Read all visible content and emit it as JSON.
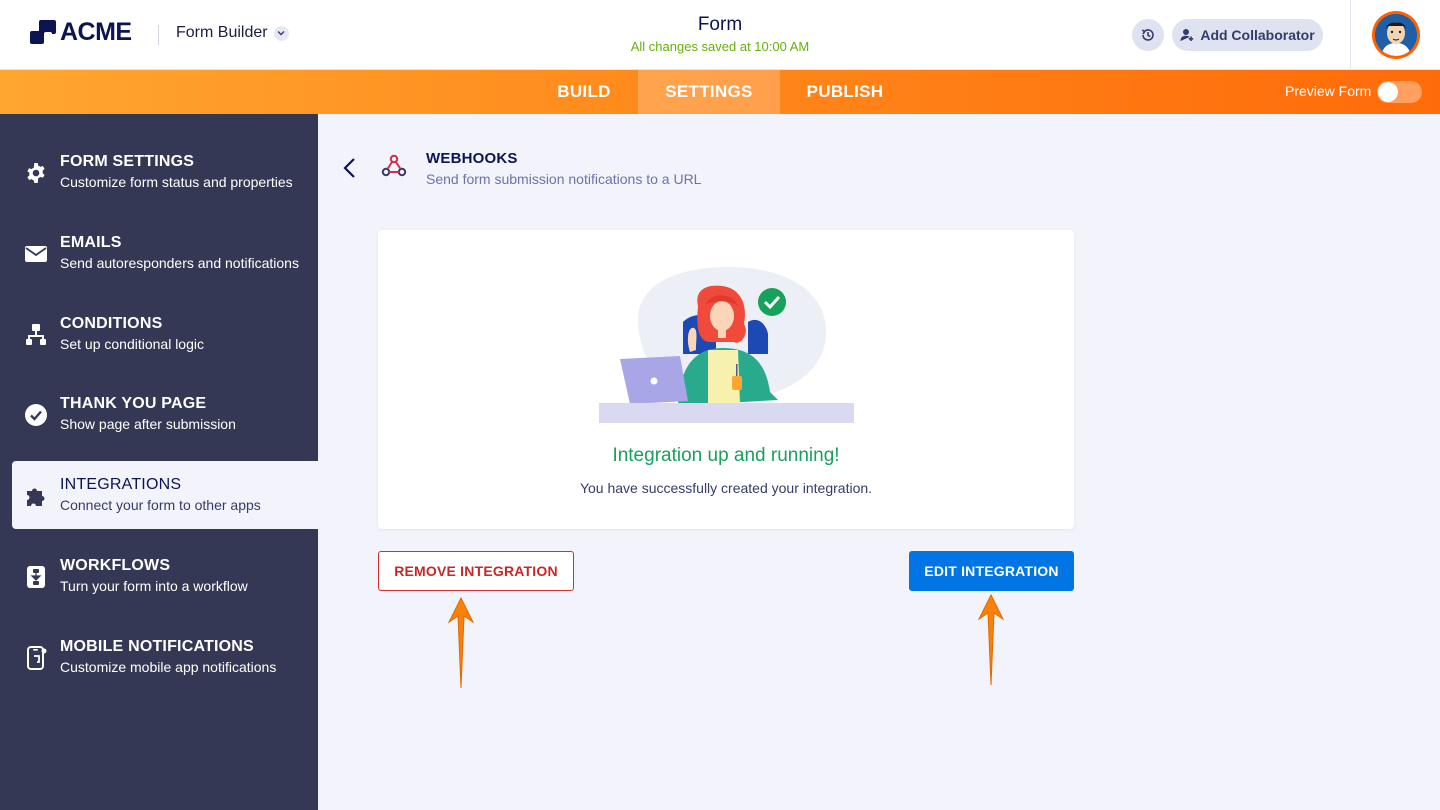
{
  "header": {
    "logo_text": "ACME",
    "app_switcher_label": "Form Builder",
    "form_title": "Form",
    "save_status": "All changes saved at 10:00 AM",
    "add_collaborator_label": "Add Collaborator"
  },
  "nav": {
    "tabs": [
      {
        "label": "BUILD",
        "active": false
      },
      {
        "label": "SETTINGS",
        "active": true
      },
      {
        "label": "PUBLISH",
        "active": false
      }
    ],
    "preview_label": "Preview Form",
    "preview_enabled": false
  },
  "sidebar": {
    "items": [
      {
        "title": "FORM SETTINGS",
        "subtitle": "Customize form status and properties",
        "icon": "gear-icon",
        "active": false
      },
      {
        "title": "EMAILS",
        "subtitle": "Send autoresponders and notifications",
        "icon": "envelope-icon",
        "active": false
      },
      {
        "title": "CONDITIONS",
        "subtitle": "Set up conditional logic",
        "icon": "flow-tree-icon",
        "active": false
      },
      {
        "title": "THANK YOU PAGE",
        "subtitle": "Show page after submission",
        "icon": "check-circle-icon",
        "active": false
      },
      {
        "title": "INTEGRATIONS",
        "subtitle": "Connect your form to other apps",
        "icon": "puzzle-icon",
        "active": true
      },
      {
        "title": "WORKFLOWS",
        "subtitle": "Turn your form into a workflow",
        "icon": "workflow-icon",
        "active": false
      },
      {
        "title": "MOBILE NOTIFICATIONS",
        "subtitle": "Customize mobile app notifications",
        "icon": "mobile-icon",
        "active": false
      }
    ]
  },
  "main": {
    "section_title": "WEBHOOKS",
    "section_subtitle": "Send form submission notifications to a URL",
    "success_title": "Integration up and running!",
    "success_message": "You have successfully created your integration.",
    "remove_button": "REMOVE INTEGRATION",
    "edit_button": "EDIT INTEGRATION"
  },
  "colors": {
    "accent_orange": "#ff6b0a",
    "sidebar_bg": "#343854",
    "success_green": "#18a15b",
    "primary_blue": "#0075e3",
    "danger_red": "#c62828"
  }
}
